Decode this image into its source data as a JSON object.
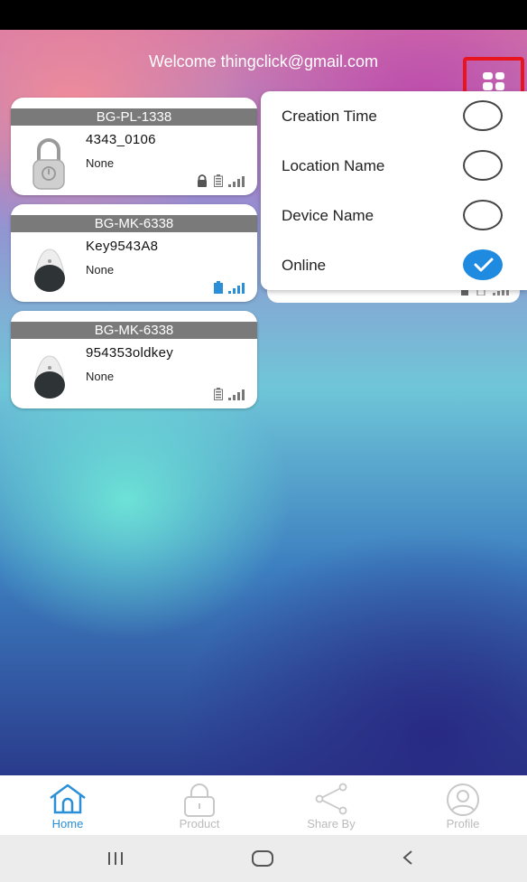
{
  "header": {
    "welcome": "Welcome thingclick@gmail.com"
  },
  "devices": [
    {
      "model": "BG-PL-1338",
      "name": "4343_0106",
      "location": "None",
      "type": "padlock"
    },
    {
      "model": "BG-MK-6338",
      "name": "Key9543A8",
      "location": "None",
      "type": "keyfob"
    },
    {
      "model": "BG-MK-6338",
      "name": "954353oldkey",
      "location": "None",
      "type": "keyfob"
    }
  ],
  "sort_menu": {
    "options": [
      {
        "label": "Creation Time",
        "selected": false
      },
      {
        "label": "Location Name",
        "selected": false
      },
      {
        "label": "Device Name",
        "selected": false
      },
      {
        "label": "Online",
        "selected": true
      }
    ]
  },
  "tabs": [
    {
      "label": "Home",
      "icon": "home-icon",
      "active": true
    },
    {
      "label": "Product",
      "icon": "lock-icon",
      "active": false
    },
    {
      "label": "Share By",
      "icon": "share-icon",
      "active": false
    },
    {
      "label": "Profile",
      "icon": "profile-icon",
      "active": false
    }
  ],
  "colors": {
    "accent": "#2a8fd6",
    "highlight": "#e8141e",
    "check": "#1e8ae0"
  }
}
